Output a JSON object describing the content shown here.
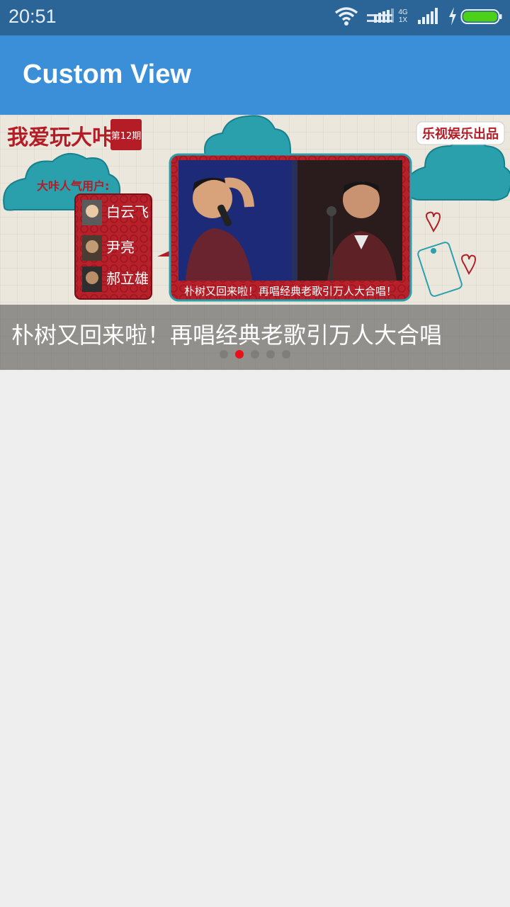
{
  "status_bar": {
    "time": "20:51",
    "network_type": "4G",
    "network_sub": "1X",
    "icons": [
      "wifi-icon",
      "signal-4g-icon",
      "signal-icon",
      "charging-icon",
      "battery-icon"
    ],
    "battery_color": "#4cd018"
  },
  "app_bar": {
    "title": "Custom View",
    "color": "#3b8fd8"
  },
  "banner": {
    "program_title": "我爱玩大咔",
    "episode": "第12期",
    "producer": "乐视娱乐出品",
    "popular_users_label": "大咔人气用户:",
    "users": [
      "白云飞",
      "尹亮",
      "郝立雄"
    ],
    "photo_caption": "朴树又回来啦！再唱经典老歌引万人大合唱！",
    "caption": "朴树又回来啦！再唱经典老歌引万人大合唱",
    "page_count": 5,
    "active_page": 2,
    "indicator_active_color": "#e8101a"
  }
}
